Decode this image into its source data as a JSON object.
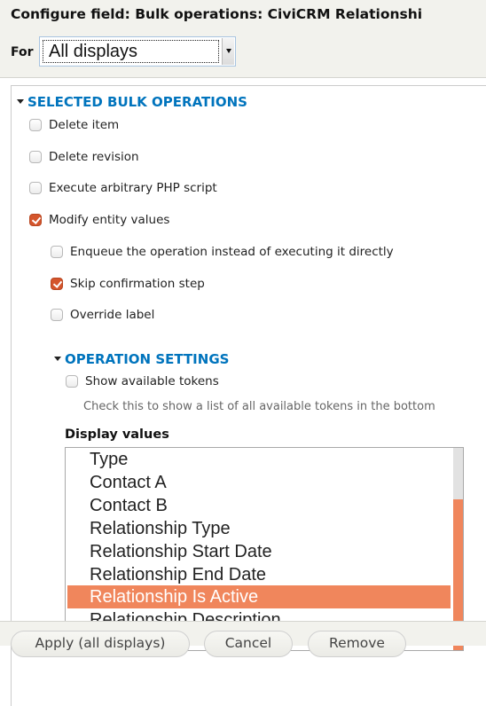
{
  "header": {
    "title": "Configure field: Bulk operations: CiviCRM Relationshi",
    "for_label": "For",
    "for_select": {
      "value": "All displays"
    }
  },
  "selected_bulk_operations": {
    "legend": "SELECTED BULK OPERATIONS",
    "options": [
      {
        "label": "Delete item",
        "checked": false
      },
      {
        "label": "Delete revision",
        "checked": false
      },
      {
        "label": "Execute arbitrary PHP script",
        "checked": false
      },
      {
        "label": "Modify entity values",
        "checked": true
      }
    ],
    "sub_options": [
      {
        "label": "Enqueue the operation instead of executing it directly",
        "checked": false
      },
      {
        "label": "Skip confirmation step",
        "checked": true
      },
      {
        "label": "Override label",
        "checked": false
      }
    ]
  },
  "operation_settings": {
    "legend": "OPERATION SETTINGS",
    "show_tokens": {
      "label": "Show available tokens",
      "checked": false
    },
    "show_tokens_description": "Check this to show a list of all available tokens in the bottom",
    "display_values_label": "Display values",
    "display_values": [
      {
        "label": "Type",
        "selected": false
      },
      {
        "label": "Contact A",
        "selected": false
      },
      {
        "label": "Contact B",
        "selected": false
      },
      {
        "label": "Relationship Type",
        "selected": false
      },
      {
        "label": "Relationship Start Date",
        "selected": false
      },
      {
        "label": "Relationship End Date",
        "selected": false
      },
      {
        "label": "Relationship Is Active",
        "selected": true
      },
      {
        "label": "Relationship Description",
        "selected": false
      }
    ]
  },
  "footer": {
    "apply_label": "Apply (all displays)",
    "cancel_label": "Cancel",
    "remove_label": "Remove"
  },
  "colors": {
    "accent": "#d4552c",
    "legend": "#0074bd",
    "selection": "#f0865c"
  }
}
